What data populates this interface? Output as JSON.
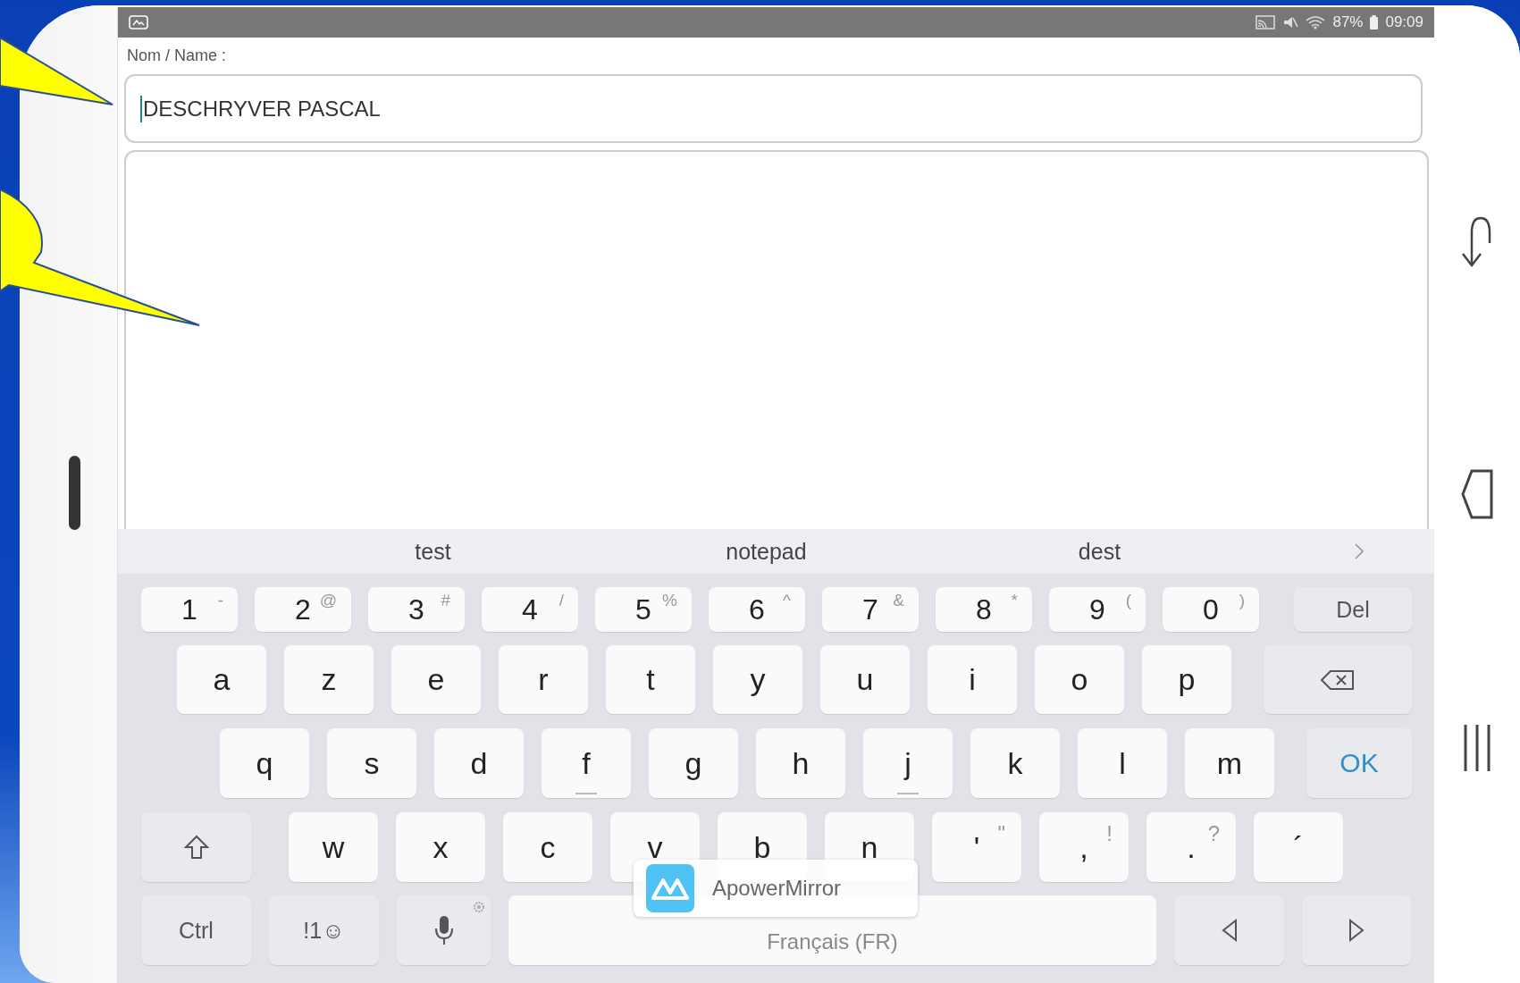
{
  "status_bar": {
    "battery": "87%",
    "time": "09:09"
  },
  "form": {
    "label": "Nom / Name :",
    "name_value": "DESCHRYVER PASCAL"
  },
  "suggestions": [
    "test",
    "notepad",
    "dest"
  ],
  "keyboard": {
    "number_keys": [
      {
        "kind": "char",
        "label": "1",
        "alt": "-"
      },
      {
        "kind": "char",
        "label": "2",
        "alt": "@"
      },
      {
        "kind": "char",
        "label": "3",
        "alt": "#"
      },
      {
        "kind": "char",
        "label": "4",
        "alt": "/"
      },
      {
        "kind": "char",
        "label": "5",
        "alt": "%"
      },
      {
        "kind": "char",
        "label": "6",
        "alt": "^"
      },
      {
        "kind": "char",
        "label": "7",
        "alt": "&"
      },
      {
        "kind": "char",
        "label": "8",
        "alt": "*"
      },
      {
        "kind": "char",
        "label": "9",
        "alt": "("
      },
      {
        "kind": "char",
        "label": "0",
        "alt": ")"
      },
      {
        "kind": "func",
        "label": "Del"
      }
    ],
    "upper_letters": [
      {
        "kind": "char",
        "label": "a"
      },
      {
        "kind": "char",
        "label": "z"
      },
      {
        "kind": "char",
        "label": "e"
      },
      {
        "kind": "char",
        "label": "r"
      },
      {
        "kind": "char",
        "label": "t"
      },
      {
        "kind": "char",
        "label": "y"
      },
      {
        "kind": "char",
        "label": "u"
      },
      {
        "kind": "char",
        "label": "i"
      },
      {
        "kind": "char",
        "label": "o"
      },
      {
        "kind": "char",
        "label": "p"
      },
      {
        "kind": "backspace"
      }
    ],
    "middle_letters": [
      {
        "kind": "char",
        "label": "q"
      },
      {
        "kind": "char",
        "label": "s"
      },
      {
        "kind": "char",
        "label": "d"
      },
      {
        "kind": "char",
        "label": "f",
        "home": true
      },
      {
        "kind": "char",
        "label": "g"
      },
      {
        "kind": "char",
        "label": "h"
      },
      {
        "kind": "char",
        "label": "j",
        "home": true
      },
      {
        "kind": "char",
        "label": "k"
      },
      {
        "kind": "char",
        "label": "l"
      },
      {
        "kind": "char",
        "label": "m"
      },
      {
        "kind": "action",
        "label": "OK"
      }
    ],
    "lower_letters": [
      {
        "kind": "shift"
      },
      {
        "kind": "char",
        "label": "w"
      },
      {
        "kind": "char",
        "label": "x"
      },
      {
        "kind": "char",
        "label": "c"
      },
      {
        "kind": "char",
        "label": "v"
      },
      {
        "kind": "char",
        "label": "b"
      },
      {
        "kind": "char",
        "label": "n"
      },
      {
        "kind": "char",
        "label": "'",
        "alt": "\""
      },
      {
        "kind": "char",
        "label": ",",
        "alt": "!"
      },
      {
        "kind": "char",
        "label": ".",
        "alt": "?"
      },
      {
        "kind": "char",
        "label": "´"
      }
    ],
    "bottom_keys": [
      {
        "kind": "func",
        "label": "Ctrl"
      },
      {
        "kind": "func",
        "label": "!1☺"
      },
      {
        "kind": "mic"
      },
      {
        "kind": "space",
        "label": "Français (FR)"
      },
      {
        "kind": "left"
      },
      {
        "kind": "right"
      }
    ]
  },
  "toast": {
    "title": "ApowerMirror"
  }
}
